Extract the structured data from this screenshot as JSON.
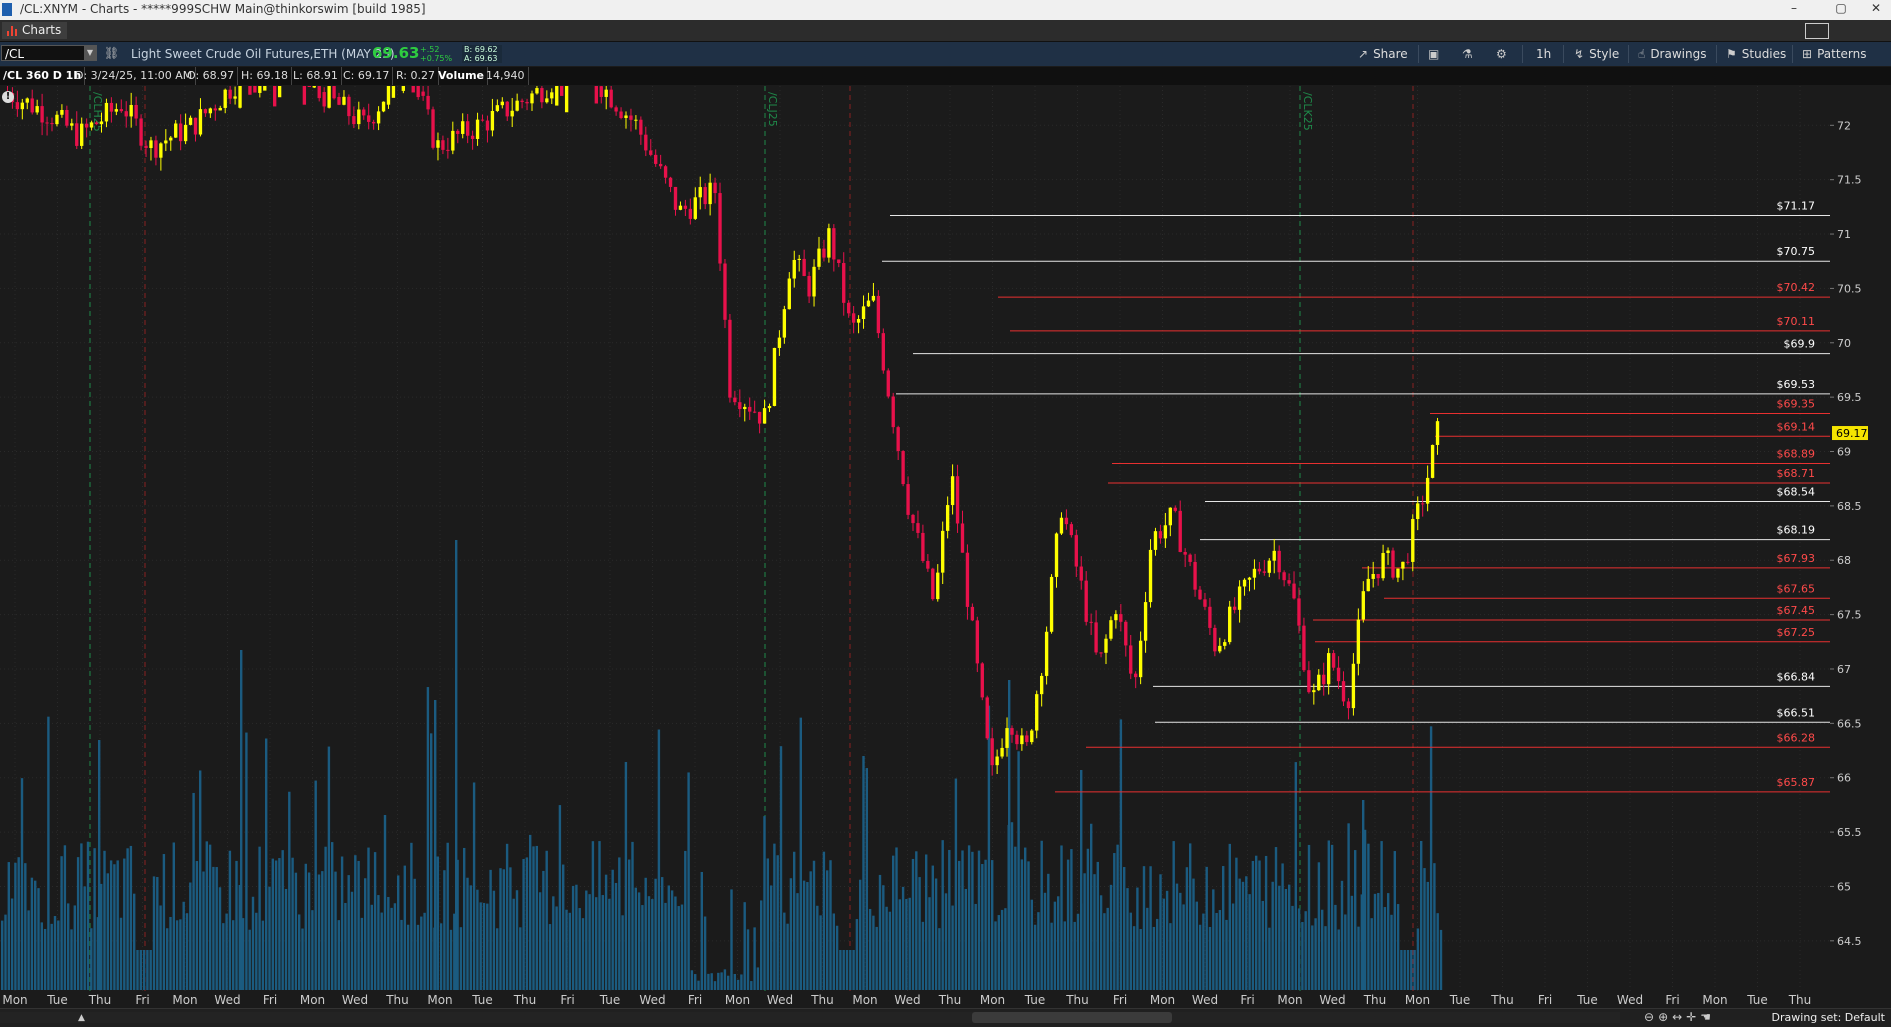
{
  "window": {
    "title": "/CL:XNYM - Charts - *****999SCHW Main@thinkorswim [build 1985]",
    "min_glyph": "–",
    "max_glyph": "▢",
    "close_glyph": "✕"
  },
  "tab": {
    "label": "Charts"
  },
  "toolbar": {
    "symbol": "/CL",
    "description": "Light Sweet Crude Oil Futures,ETH (MAY 25)",
    "last": "69.63",
    "change": "+.52",
    "change_pct": "+0.75%",
    "bid": "B: 69.62",
    "ask": "A: 69.63",
    "share_label": "Share",
    "timeframe_label": "1h",
    "style_label": "Style",
    "drawings_label": "Drawings",
    "studies_label": "Studies",
    "patterns_label": "Patterns"
  },
  "info": {
    "period": "/CL 360 D 1h",
    "date": "D: 3/24/25, 11:00 AM",
    "open": "O: 68.97",
    "high": "H: 69.18",
    "low": "L: 68.91",
    "close": "C: 69.17",
    "range": "R: 0.27",
    "volume_label": "Volume",
    "volume": "14,940"
  },
  "colors": {
    "up_candle": "#ffff00",
    "down_candle": "#e8114b",
    "volume_bar": "#1b5b80",
    "white_level": "#e6e6e6",
    "red_level": "#e83030",
    "current_price_bg": "#f5e400",
    "toolbar_bg": "#1f3045"
  },
  "chart_data": {
    "type": "candlestick",
    "y_axis_ticks": [
      "72",
      "71.5",
      "71",
      "70.5",
      "70",
      "69.5",
      "69",
      "68.5",
      "68",
      "67.5",
      "67",
      "66.5",
      "66",
      "65.5",
      "65",
      "64.5"
    ],
    "ylim": [
      64.25,
      72.15
    ],
    "current_price": "69.17",
    "contract_rolls": [
      "/CLH25",
      "/CLJ25",
      "/CLK25"
    ],
    "levels": [
      {
        "price": 71.17,
        "label": "$71.17",
        "color": "white"
      },
      {
        "price": 70.75,
        "label": "$70.75",
        "color": "white"
      },
      {
        "price": 70.42,
        "label": "$70.42",
        "color": "red"
      },
      {
        "price": 70.11,
        "label": "$70.11",
        "color": "red"
      },
      {
        "price": 69.9,
        "label": "$69.9",
        "color": "white"
      },
      {
        "price": 69.53,
        "label": "$69.53",
        "color": "white"
      },
      {
        "price": 69.35,
        "label": "$69.35",
        "color": "red"
      },
      {
        "price": 69.14,
        "label": "$69.14",
        "color": "red"
      },
      {
        "price": 68.89,
        "label": "$68.89",
        "color": "red"
      },
      {
        "price": 68.71,
        "label": "$68.71",
        "color": "red"
      },
      {
        "price": 68.54,
        "label": "$68.54",
        "color": "white"
      },
      {
        "price": 68.19,
        "label": "$68.19",
        "color": "white"
      },
      {
        "price": 67.93,
        "label": "$67.93",
        "color": "red"
      },
      {
        "price": 67.65,
        "label": "$67.65",
        "color": "red"
      },
      {
        "price": 67.45,
        "label": "$67.45",
        "color": "red"
      },
      {
        "price": 67.25,
        "label": "$67.25",
        "color": "red"
      },
      {
        "price": 66.84,
        "label": "$66.84",
        "color": "white"
      },
      {
        "price": 66.51,
        "label": "$66.51",
        "color": "white"
      },
      {
        "price": 66.28,
        "label": "$66.28",
        "color": "red"
      },
      {
        "price": 65.87,
        "label": "$65.87",
        "color": "red"
      }
    ],
    "x_axis_labels": [
      "Mon",
      "Tue",
      "Thu",
      "Fri",
      "Mon",
      "Wed",
      "Fri",
      "Mon",
      "Wed",
      "Thu",
      "Mon",
      "Tue",
      "Thu",
      "Fri",
      "Tue",
      "Wed",
      "Fri",
      "Mon",
      "Wed",
      "Thu",
      "Mon",
      "Wed",
      "Thu",
      "Mon",
      "Tue",
      "Thu",
      "Fri",
      "Mon",
      "Wed",
      "Fri",
      "Mon",
      "Wed",
      "Thu",
      "Mon",
      "Tue",
      "Thu",
      "Fri",
      "Tue",
      "Wed",
      "Fri",
      "Mon",
      "Tue",
      "Thu"
    ],
    "price_path": [
      {
        "t": 0.0,
        "p": 72.3
      },
      {
        "t": 0.03,
        "p": 72.1
      },
      {
        "t": 0.05,
        "p": 71.9
      },
      {
        "t": 0.08,
        "p": 72.2
      },
      {
        "t": 0.1,
        "p": 71.8
      },
      {
        "t": 0.13,
        "p": 72.0
      },
      {
        "t": 0.16,
        "p": 72.4
      },
      {
        "t": 0.2,
        "p": 72.5
      },
      {
        "t": 0.25,
        "p": 72.0
      },
      {
        "t": 0.28,
        "p": 72.6
      },
      {
        "t": 0.3,
        "p": 71.8
      },
      {
        "t": 0.33,
        "p": 72.0
      },
      {
        "t": 0.37,
        "p": 72.3
      },
      {
        "t": 0.4,
        "p": 72.6
      },
      {
        "t": 0.44,
        "p": 72.0
      },
      {
        "t": 0.47,
        "p": 71.2
      },
      {
        "t": 0.495,
        "p": 71.4
      },
      {
        "t": 0.505,
        "p": 69.6
      },
      {
        "t": 0.53,
        "p": 69.3
      },
      {
        "t": 0.548,
        "p": 70.8
      },
      {
        "t": 0.56,
        "p": 70.5
      },
      {
        "t": 0.575,
        "p": 71.0
      },
      {
        "t": 0.59,
        "p": 70.1
      },
      {
        "t": 0.605,
        "p": 70.4
      },
      {
        "t": 0.63,
        "p": 68.5
      },
      {
        "t": 0.648,
        "p": 67.6
      },
      {
        "t": 0.66,
        "p": 68.8
      },
      {
        "t": 0.675,
        "p": 67.3
      },
      {
        "t": 0.688,
        "p": 66.0
      },
      {
        "t": 0.7,
        "p": 66.6
      },
      {
        "t": 0.712,
        "p": 66.2
      },
      {
        "t": 0.725,
        "p": 67.2
      },
      {
        "t": 0.737,
        "p": 68.5
      },
      {
        "t": 0.75,
        "p": 67.8
      },
      {
        "t": 0.763,
        "p": 67.0
      },
      {
        "t": 0.775,
        "p": 67.6
      },
      {
        "t": 0.788,
        "p": 66.8
      },
      {
        "t": 0.8,
        "p": 68.2
      },
      {
        "t": 0.815,
        "p": 68.4
      },
      {
        "t": 0.83,
        "p": 67.8
      },
      {
        "t": 0.845,
        "p": 67.2
      },
      {
        "t": 0.86,
        "p": 67.6
      },
      {
        "t": 0.873,
        "p": 67.9
      },
      {
        "t": 0.887,
        "p": 68.1
      },
      {
        "t": 0.9,
        "p": 67.6
      },
      {
        "t": 0.912,
        "p": 66.7
      },
      {
        "t": 0.925,
        "p": 67.1
      },
      {
        "t": 0.937,
        "p": 66.7
      },
      {
        "t": 0.95,
        "p": 67.8
      },
      {
        "t": 0.962,
        "p": 68.0
      },
      {
        "t": 0.975,
        "p": 67.9
      },
      {
        "t": 0.99,
        "p": 68.6
      },
      {
        "t": 1.0,
        "p": 69.17
      }
    ]
  },
  "status": {
    "drawing_set": "Drawing set: Default"
  }
}
